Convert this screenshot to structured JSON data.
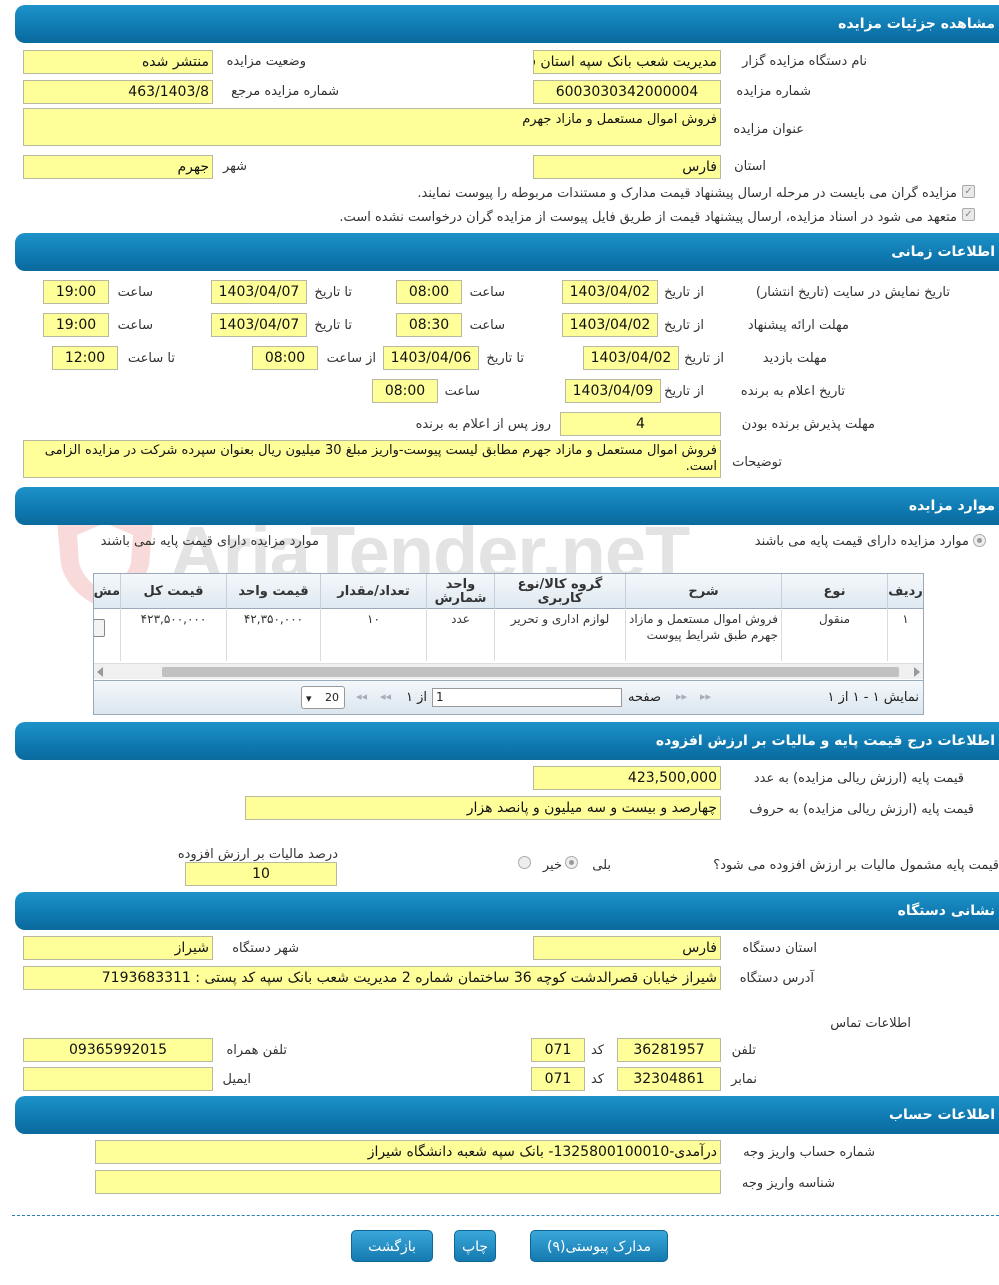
{
  "sections": {
    "details": "مشاهده جزئیات مزایده",
    "timing": "اطلاعات زمانی",
    "items": "موارد مزایده",
    "price": "اطلاعات درج قیمت پایه و مالیات بر ارزش افزوده",
    "address": "نشانی دستگاه",
    "account": "اطلاعات حساب"
  },
  "details": {
    "org_label": "نام دستگاه مزایده گزار",
    "org_value": "مدیریت شعب بانک سپه استان فارس",
    "status_label": "وضعیت مزایده",
    "status_value": "منتشر شده",
    "number_label": "شماره مزایده",
    "number_value": "6003030342000004",
    "ref_label": "شماره مزایده مرجع",
    "ref_value": "463/1403/8",
    "title_label": "عنوان مزایده",
    "title_value": "فروش اموال مستعمل و مازاد جهرم",
    "province_label": "استان",
    "province_value": "فارس",
    "city_label": "شهر",
    "city_value": "جهرم",
    "check1": "مزایده گران می بایست در مرحله ارسال پیشنهاد قیمت مدارک و مستندات مربوطه را پیوست نمایند.",
    "check2": "متعهد می شود در اسناد مزایده، ارسال پیشنهاد قیمت از طریق فایل پیوست از مزایده گران درخواست نشده است."
  },
  "timing": {
    "from_date": "از تاریخ",
    "to_date": "تا تاریخ",
    "time": "ساعت",
    "from_time": "از ساعت",
    "to_time": "تا ساعت",
    "publish_label": "تاریخ نمایش در سایت (تاریخ انتشار)",
    "publish": [
      "1403/04/02",
      "08:00",
      "1403/04/07",
      "19:00"
    ],
    "offer_label": "مهلت ارائه پیشنهاد",
    "offer": [
      "1403/04/02",
      "08:30",
      "1403/04/07",
      "19:00"
    ],
    "visit_label": "مهلت بازدید",
    "visit": [
      "1403/04/02",
      "1403/04/06",
      "08:00",
      "12:00"
    ],
    "announce_label": "تاریخ اعلام به برنده",
    "announce": [
      "1403/04/09",
      "08:00"
    ],
    "accept_label": "مهلت پذیرش برنده بودن",
    "accept_value": "4",
    "accept_suffix": "روز پس از اعلام به برنده",
    "desc_label": "توضیحات",
    "desc_value": "فروش اموال مستعمل و مازاد جهرم مطابق لیست پیوست-واریز مبلغ 30 میلیون ریال بعنوان سپرده شرکت در مزایده الزامی است."
  },
  "items": {
    "radio_yes": "موارد مزایده دارای قیمت پایه می باشند",
    "radio_no": "موارد مزایده دارای قیمت پایه نمی باشند",
    "columns": [
      "ردیف",
      "نوع",
      "شرح",
      "گروه کالا/نوع کاربری",
      "واحد شمارش",
      "تعداد/مقدار",
      "قیمت واحد",
      "قیمت کل",
      "مش"
    ],
    "row": [
      "۱",
      "منقول",
      "فروش اموال مستعمل و مازاد جهرم طبق شرایط پیوست",
      "لوازم اداری و تحریر",
      "عدد",
      "۱۰",
      "۴۲,۳۵۰,۰۰۰",
      "۴۲۳,۵۰۰,۰۰۰"
    ],
    "summary": "نمایش ۱ - ۱ از ۱",
    "page_label": "صفحه",
    "page_value": "1",
    "of_pages": "از ۱",
    "page_size": "20"
  },
  "price": {
    "base_num_label": "قیمت پایه (ارزش ریالی مزایده) به عدد",
    "base_num_value": "423,500,000",
    "base_text_label": "قیمت پایه (ارزش ریالی مزایده) به حروف",
    "base_text_value": "چهارصد و بیست و سه میلیون و پانصد هزار",
    "vat_question": "قیمت پایه مشمول مالیات بر ارزش افزوده می شود؟",
    "yes": "بلی",
    "no": "خیر",
    "vat_percent_label": "درصد مالیات بر ارزش افزوده",
    "vat_percent_value": "10"
  },
  "address": {
    "province_label": "استان دستگاه",
    "province_value": "فارس",
    "city_label": "شهر دستگاه",
    "city_value": "شیراز",
    "addr_label": "آدرس دستگاه",
    "addr_value": "شیراز خیابان قصرالدشت کوچه 36 ساختمان شماره 2 مدیریت شعب بانک سپه کد پستی : 7193683311",
    "contact_label": "اطلاعات تماس",
    "phone_label": "تلفن",
    "phone_value": "36281957",
    "code_label": "کد",
    "phone_code": "071",
    "mobile_label": "تلفن همراه",
    "mobile_value": "09365992015",
    "fax_label": "نمابر",
    "fax_value": "32304861",
    "fax_code": "071",
    "email_label": "ایمیل",
    "email_value": ""
  },
  "account": {
    "acc_label": "شماره حساب واریز وجه",
    "acc_value": "درآمدی-1325800100010- بانک سپه شعبه دانشگاه شیراز",
    "id_label": "شناسه واریز وجه",
    "id_value": ""
  },
  "buttons": {
    "attachments": "مدارک پیوستی(۹)",
    "print": "چاپ",
    "back": "بازگشت"
  },
  "watermark": "AriaTender.neT"
}
